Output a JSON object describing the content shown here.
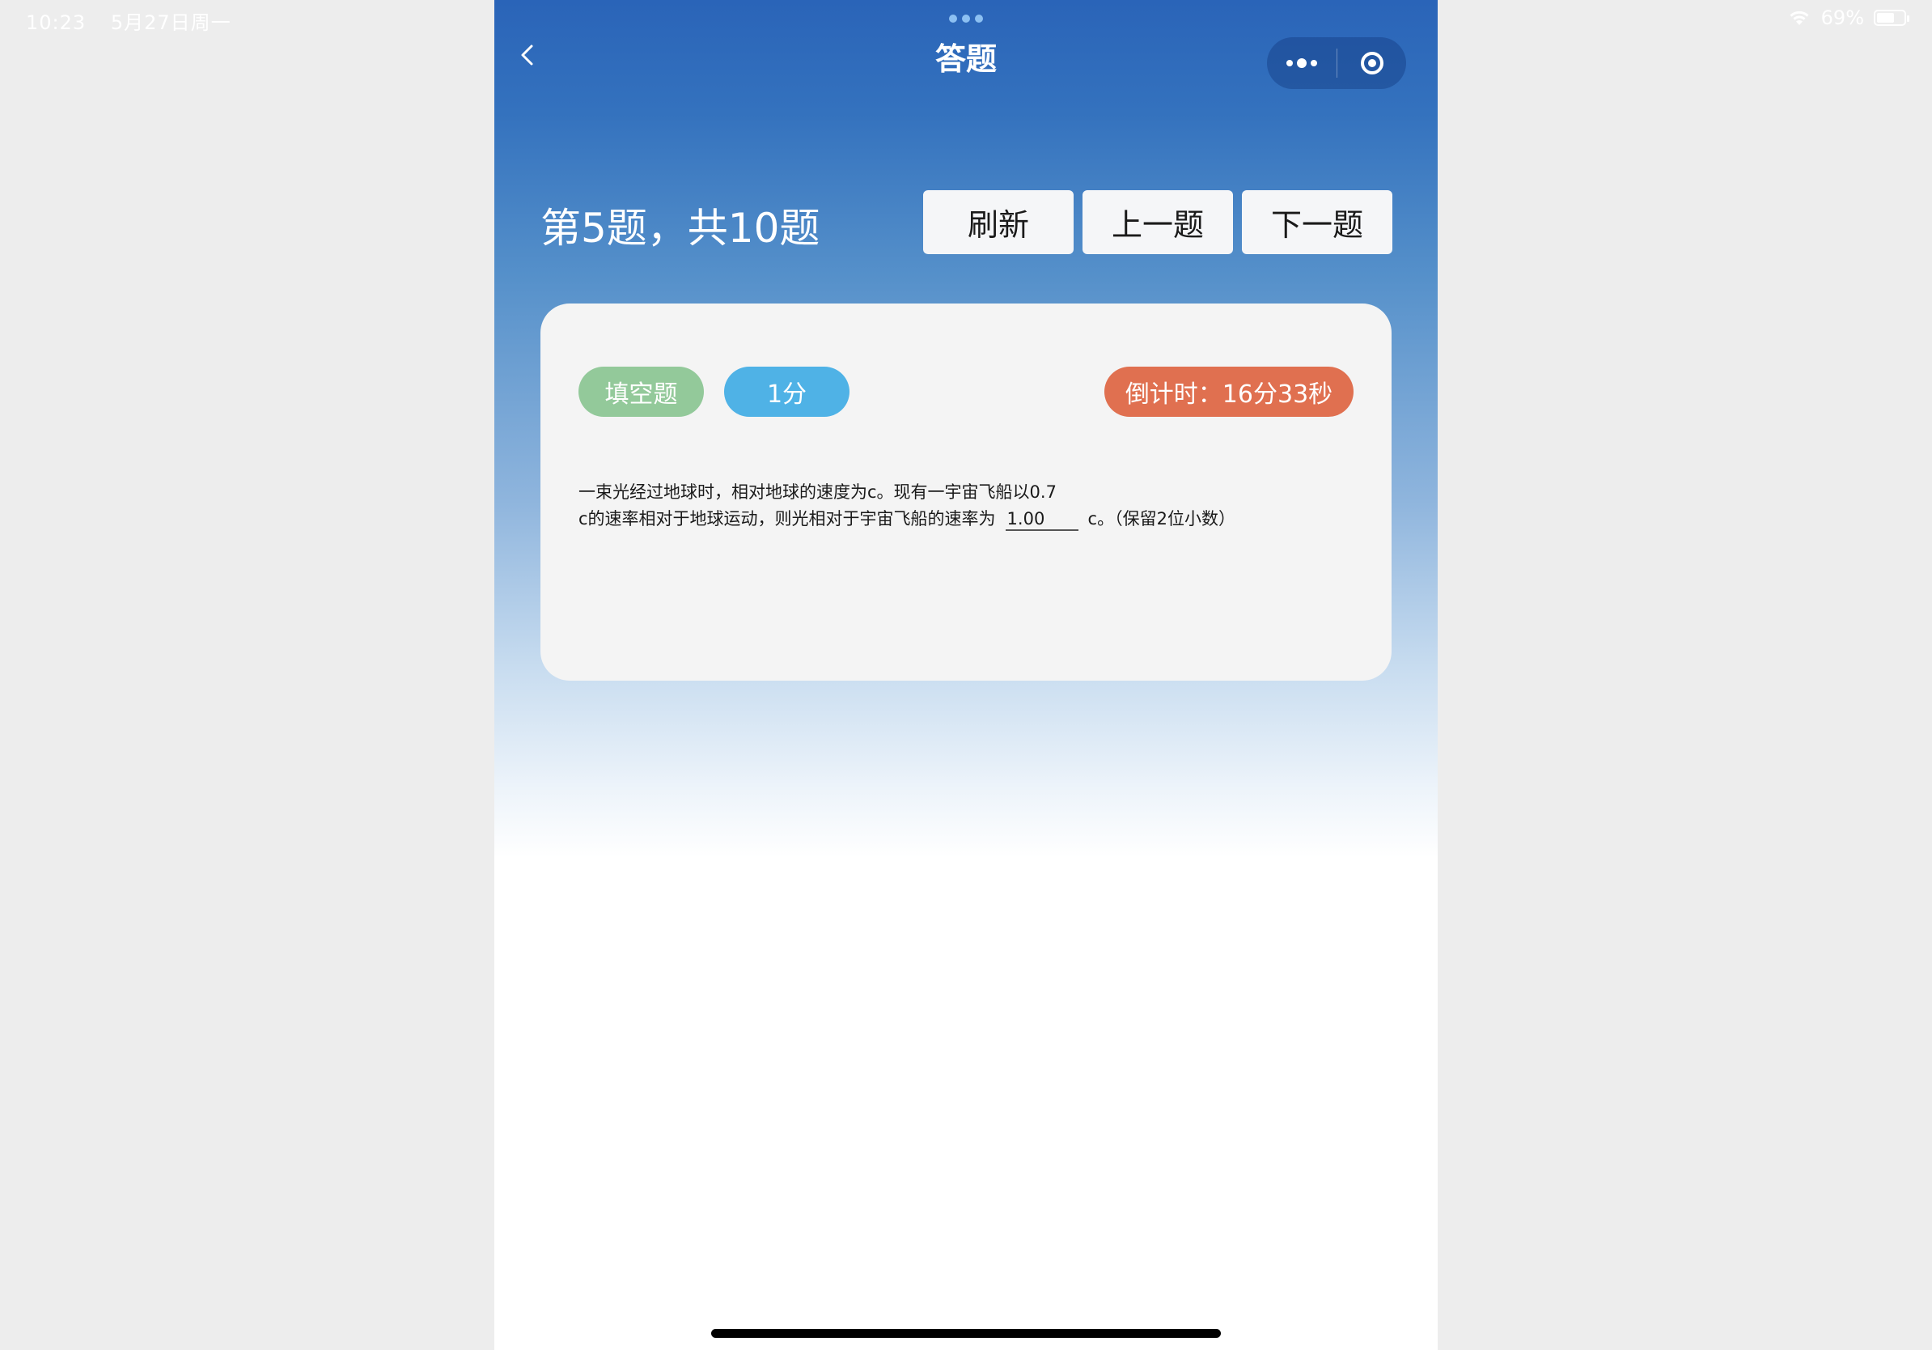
{
  "status_bar": {
    "time": "10:23",
    "date": "5月27日周一",
    "battery": "69%",
    "battery_level": 0.69
  },
  "nav": {
    "title": "答题"
  },
  "header": {
    "progress": "第5题，共10题",
    "refresh_label": "刷新",
    "prev_label": "上一题",
    "next_label": "下一题"
  },
  "card": {
    "type_tag": "填空题",
    "score_tag": "1分",
    "timer": "倒计时：16分33秒",
    "question_line1": "一束光经过地球时，相对地球的速度为c。现有一宇宙飞船以0.7",
    "question_line2_before": "c的速率相对于地球运动，则光相对于宇宙飞船的速率为",
    "answer": "1.00",
    "question_line2_after": "c。（保留2位小数）"
  },
  "colors": {
    "header_blue": "#2a64b8",
    "tag_type": "#93c99a",
    "tag_score": "#4fb2e6",
    "tag_timer": "#e07050",
    "card_bg": "#f4f4f4"
  }
}
